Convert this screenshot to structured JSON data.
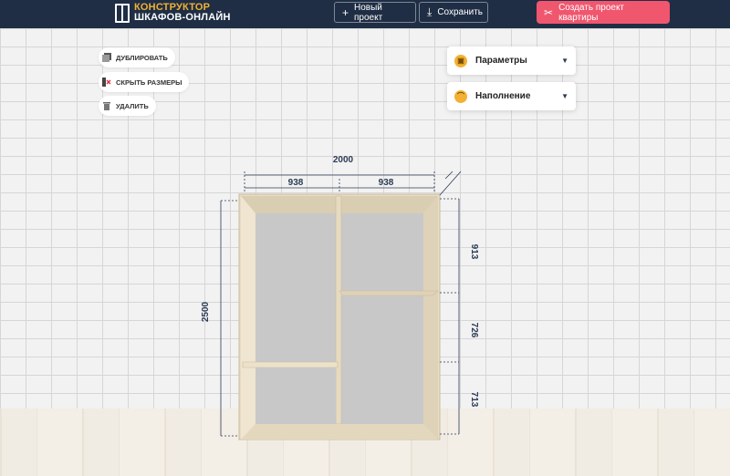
{
  "header": {
    "logo_line1": "КОНСТРУКТОР",
    "logo_line2": "ШКАФОВ-ОНЛАЙН",
    "new_project": "Новый проект",
    "save": "Сохранить",
    "create_apartment": "Создать проект квартиры"
  },
  "tools": {
    "duplicate": "ДУБЛИРОВАТЬ",
    "hide_sizes": "СКРЫТЬ РАЗМЕРЫ",
    "delete": "УДАЛИТЬ"
  },
  "panels": {
    "params": "Параметры",
    "filling": "Наполнение"
  },
  "dimensions": {
    "total_width": "2000",
    "left_section": "938",
    "right_section": "938",
    "height": "2500",
    "upper": "913",
    "middle": "726",
    "lower": "713"
  },
  "colors": {
    "header_bg": "#1f2e44",
    "accent": "#f2b134",
    "create_btn": "#f0566e",
    "wardrobe": "#e8dcc3"
  }
}
